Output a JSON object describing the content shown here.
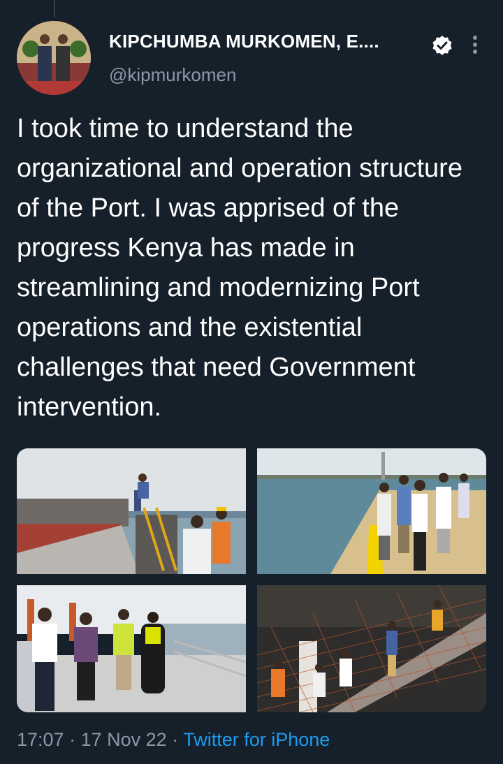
{
  "author": {
    "display_name": "KIPCHUMBA MURKOMEN, E....",
    "handle": "@kipmurkomen",
    "verified": true
  },
  "icons": {
    "verified": "verified-badge-icon",
    "more": "more-options-icon"
  },
  "tweet": {
    "text": "I took time to understand the organizational and operation structure of the Port. I was apprised of the progress Kenya has made in streamlining and modernizing Port operations and the existential challenges that need Government intervention.",
    "photo_count": 4
  },
  "meta": {
    "time": "17:07",
    "date": "17 Nov 22",
    "separator": " · ",
    "source": "Twitter for iPhone"
  },
  "colors": {
    "background": "#15202b",
    "secondary_text": "#8b98a5",
    "link": "#1d9bf0"
  }
}
